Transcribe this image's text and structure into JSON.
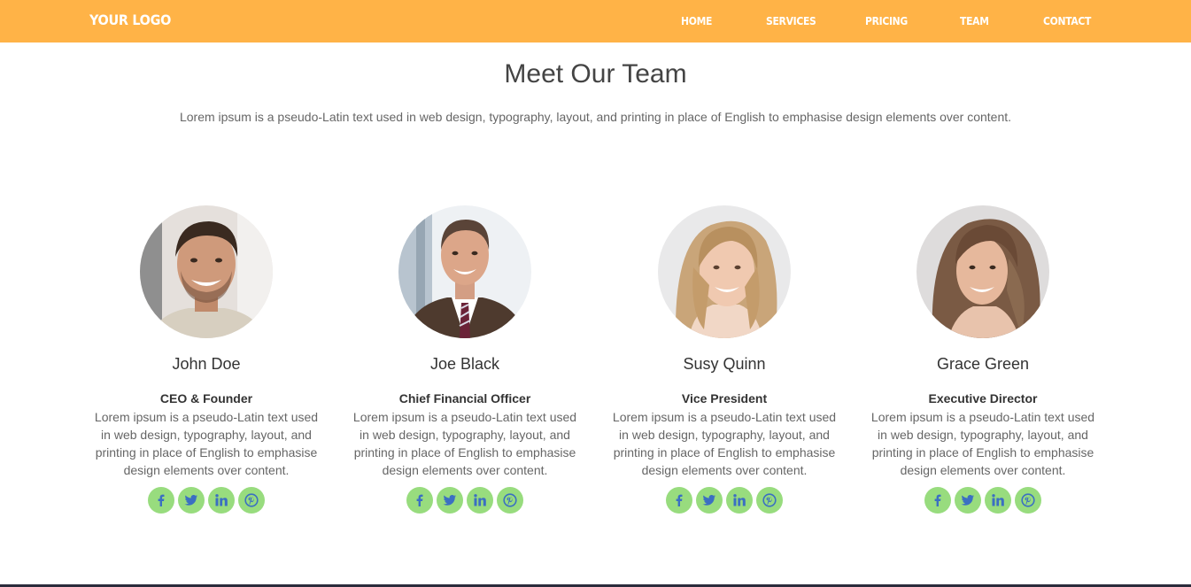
{
  "nav": {
    "logo": "YOUR LOGO",
    "links": [
      "HOME",
      "SERVICES",
      "PRICING",
      "TEAM",
      "CONTACT"
    ]
  },
  "section": {
    "title": "Meet Our Team",
    "intro": "Lorem ipsum is a pseudo-Latin text used in web design, typography, layout, and printing in place of English to emphasise design elements over content."
  },
  "members": [
    {
      "name": "John Doe",
      "role": "CEO & Founder",
      "description": "Lorem ipsum is a pseudo-Latin text used in web design, typography, layout, and printing in place of English to emphasise design elements over content."
    },
    {
      "name": "Joe Black",
      "role": "Chief Financial Officer",
      "description": "Lorem ipsum is a pseudo-Latin text used in web design, typography, layout, and printing in place of English to emphasise design elements over content."
    },
    {
      "name": "Susy Quinn",
      "role": "Vice President",
      "description": "Lorem ipsum is a pseudo-Latin text used in web design, typography, layout, and printing in place of English to emphasise design elements over content."
    },
    {
      "name": "Grace Green",
      "role": "Executive Director",
      "description": "Lorem ipsum is a pseudo-Latin text used in web design, typography, layout, and printing in place of English to emphasise design elements over content."
    }
  ],
  "social_icons": [
    "facebook-icon",
    "twitter-icon",
    "linkedin-icon",
    "pinterest-icon"
  ],
  "colors": {
    "navbar": "#ffb347",
    "social_background": "#98dc7e",
    "social_icon": "#3b6fc2"
  }
}
